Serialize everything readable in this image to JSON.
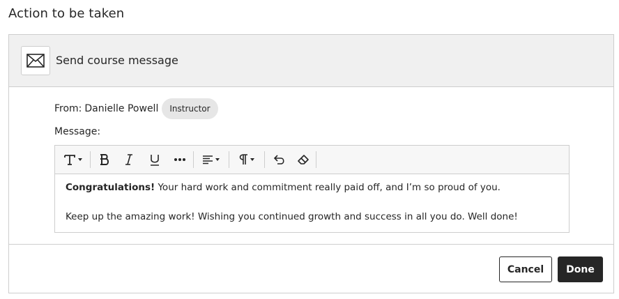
{
  "page": {
    "title": "Action to be taken"
  },
  "action": {
    "title": "Send course message",
    "icon": "envelope-icon"
  },
  "from": {
    "label": "From:",
    "name": "Danielle Powell",
    "role": "Instructor"
  },
  "message": {
    "label": "Message:",
    "toolbar": [
      {
        "name": "text-style",
        "icon": "text-type-icon",
        "dropdown": true
      },
      {
        "name": "bold",
        "icon": "bold-icon"
      },
      {
        "name": "italic",
        "icon": "italic-icon"
      },
      {
        "name": "underline",
        "icon": "underline-icon"
      },
      {
        "name": "more",
        "icon": "more-horizontal-icon"
      },
      {
        "name": "align",
        "icon": "align-left-icon",
        "dropdown": true
      },
      {
        "name": "paragraph",
        "icon": "paragraph-icon",
        "dropdown": true
      },
      {
        "name": "undo",
        "icon": "undo-icon"
      },
      {
        "name": "clear-format",
        "icon": "eraser-icon"
      }
    ],
    "body": {
      "p1_bold": "Congratulations!",
      "p1_rest": " Your hard work and commitment really paid off, and I’m so proud of you.",
      "p2": "Keep up the amazing work! Wishing you continued growth and success in all you do. Well done!"
    }
  },
  "buttons": {
    "cancel": "Cancel",
    "done": "Done"
  },
  "colors": {
    "text": "#262626",
    "border": "#cdcdcd",
    "header_bg": "#f0f0f0",
    "badge_bg": "#e6e6e6",
    "primary_button": "#262626"
  }
}
